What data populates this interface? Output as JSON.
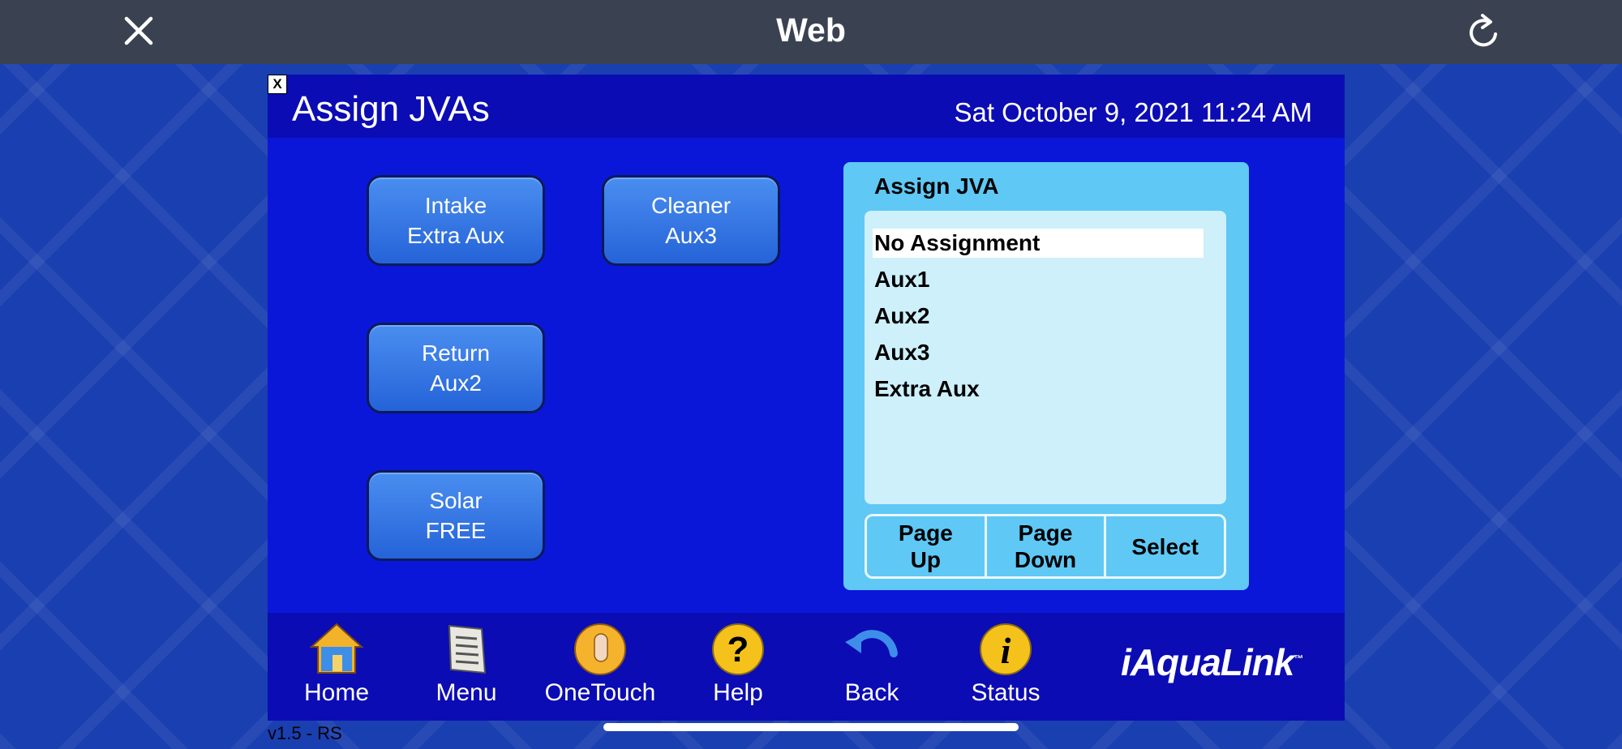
{
  "topbar": {
    "title": "Web",
    "close_icon": "close-icon",
    "reload_icon": "reload-icon"
  },
  "panel": {
    "close_glyph": "X",
    "title": "Assign JVAs",
    "datetime": "Sat October 9, 2021 11:24 AM"
  },
  "jvas": [
    {
      "name": "Intake",
      "assignment": "Extra Aux"
    },
    {
      "name": "Cleaner",
      "assignment": "Aux3"
    },
    {
      "name": "Return",
      "assignment": "Aux2"
    },
    {
      "name": "Solar",
      "assignment": "FREE"
    }
  ],
  "assign_box": {
    "title": "Assign JVA",
    "options": [
      "No Assignment",
      "Aux1",
      "Aux2",
      "Aux3",
      "Extra Aux"
    ],
    "selected": "No Assignment",
    "buttons": {
      "page_up_1": "Page",
      "page_up_2": "Up",
      "page_down_1": "Page",
      "page_down_2": "Down",
      "select": "Select"
    }
  },
  "bottom_nav": [
    {
      "label": "Home",
      "icon": "home-icon"
    },
    {
      "label": "Menu",
      "icon": "menu-icon"
    },
    {
      "label": "OneTouch",
      "icon": "onetouch-icon"
    },
    {
      "label": "Help",
      "icon": "help-icon"
    },
    {
      "label": "Back",
      "icon": "back-icon"
    },
    {
      "label": "Status",
      "icon": "status-icon"
    }
  ],
  "logo": {
    "text": "iAquaLink",
    "tm": "™"
  },
  "version": "v1.5 - RS",
  "colors": {
    "panel_bg": "#0b17d8",
    "header_bg": "#0c0cb4",
    "button": "#2f74e0",
    "assign_box": "#5fc8f5",
    "list_bg": "#cdf0fb"
  }
}
